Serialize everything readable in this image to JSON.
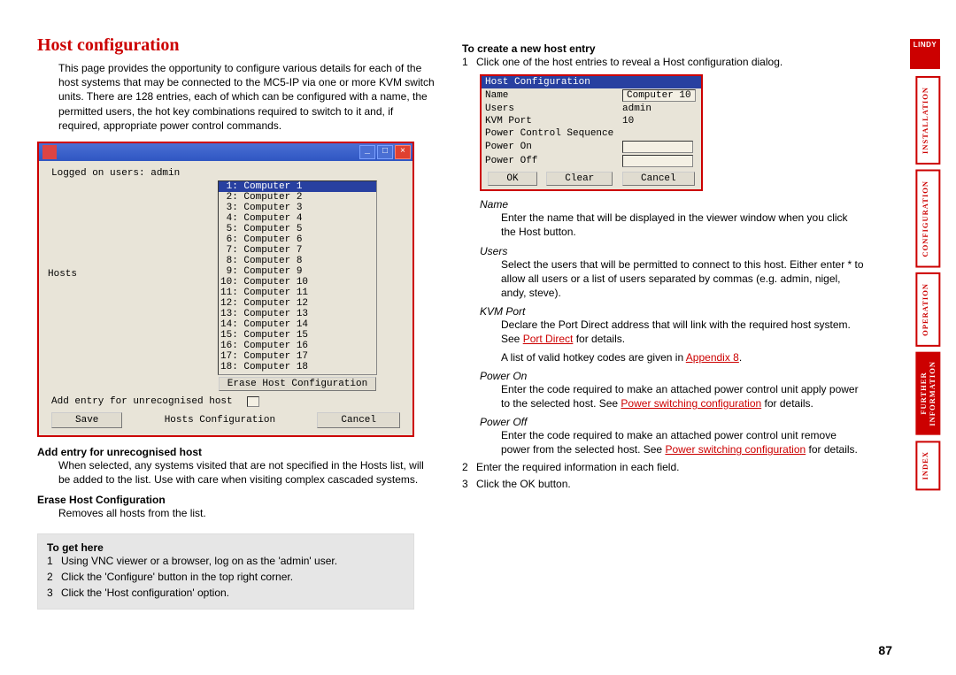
{
  "page": {
    "title": "Host configuration",
    "intro": "This page provides the opportunity to configure various details for each of the host systems that may be connected to the MC5-IP via one or more KVM switch units. There are 128 entries, each of which can be configured with a name, the permitted users, the hot key combinations required to switch to it and, if required, appropriate power control commands.",
    "page_number": "87"
  },
  "logo": {
    "text": "LINDY"
  },
  "hosts_window": {
    "logged_label": "Logged on users: admin",
    "hosts_label": "Hosts",
    "items": [
      " 1: Computer 1",
      " 2: Computer 2",
      " 3: Computer 3",
      " 4: Computer 4",
      " 5: Computer 5",
      " 6: Computer 6",
      " 7: Computer 7",
      " 8: Computer 8",
      " 9: Computer 9",
      "10: Computer 10",
      "11: Computer 11",
      "12: Computer 12",
      "13: Computer 13",
      "14: Computer 14",
      "15: Computer 15",
      "16: Computer 16",
      "17: Computer 17",
      "18: Computer 18"
    ],
    "selected_index": 0,
    "erase_btn": "Erase Host Configuration",
    "add_label": "Add entry for unrecognised host",
    "save_btn": "Save",
    "center_label": "Hosts Configuration",
    "cancel_btn": "Cancel"
  },
  "left_sections": {
    "add_entry": {
      "heading": "Add entry for unrecognised host",
      "body": "When selected, any systems visited that are not specified in the Hosts list, will be added to the list. Use with care when visiting complex cascaded systems."
    },
    "erase": {
      "heading": "Erase Host Configuration",
      "body": "Removes all hosts from the list."
    }
  },
  "gethere": {
    "heading": "To get here",
    "steps": [
      "Using VNC viewer or a browser, log on as the 'admin' user.",
      "Click the 'Configure' button in the top right corner.",
      "Click the 'Host configuration' option."
    ]
  },
  "right_col": {
    "create_heading": "To create a new host entry",
    "step1": "Click one of the host entries to reveal a Host configuration dialog.",
    "step2": "Enter the required information in each field.",
    "step3": "Click the OK button."
  },
  "hc_dialog": {
    "title": "Host Configuration",
    "rows": {
      "name": {
        "label": "Name",
        "value": "Computer 10"
      },
      "users": {
        "label": "Users",
        "value": "admin"
      },
      "kvm": {
        "label": "KVM Port",
        "value": "10"
      },
      "power_seq": {
        "label": "Power Control Sequence"
      },
      "power_on": {
        "label": "Power On",
        "value": ""
      },
      "power_off": {
        "label": "Power Off",
        "value": ""
      }
    },
    "ok": "OK",
    "clear": "Clear",
    "cancel": "Cancel"
  },
  "fields_help": {
    "name": {
      "label": "Name",
      "body": "Enter the name that will be displayed in the viewer window when you click the Host button."
    },
    "users": {
      "label": "Users",
      "body": "Select the users that will be permitted to connect to this host. Either enter * to allow all users or a list of users separated by commas (e.g. admin, nigel, andy, steve)."
    },
    "kvm": {
      "label": "KVM Port",
      "body_pre": "Declare the Port Direct address that will link with the required host system. See ",
      "link1": "Port Direct",
      "body_mid": " for details.",
      "body2_pre": "A list of valid hotkey codes are given in ",
      "link2": "Appendix 8",
      "body2_post": "."
    },
    "power_on": {
      "label": "Power On",
      "body_pre": "Enter the code required to make an attached power control unit apply power to the selected host. See ",
      "link": "Power switching configuration",
      "body_post": " for details."
    },
    "power_off": {
      "label": "Power Off",
      "body_pre": "Enter the code required to make an attached power control unit remove power from the selected host. See ",
      "link": "Power switching configuration",
      "body_post": " for details."
    }
  },
  "sidenav": {
    "installation": "INSTALLATION",
    "configuration": "CONFIGURATION",
    "operation": "OPERATION",
    "further": "FURTHER\nINFORMATION",
    "index": "INDEX"
  }
}
